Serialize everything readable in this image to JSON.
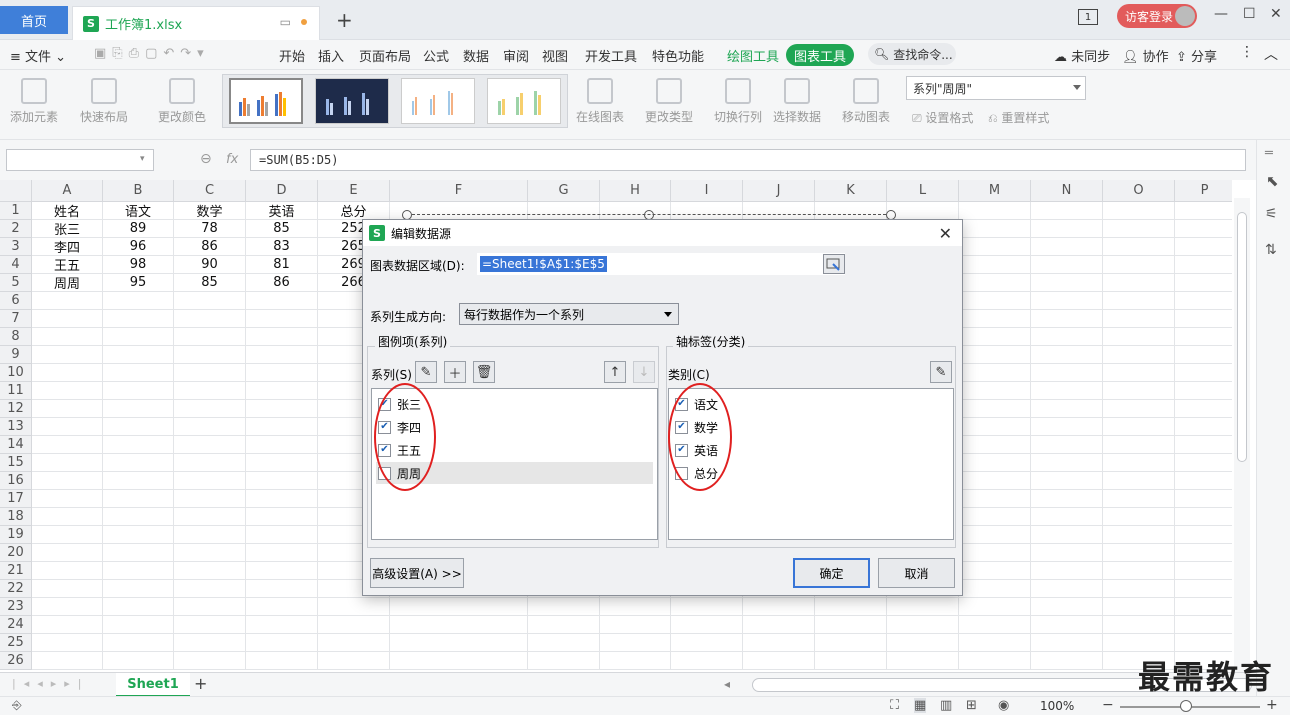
{
  "titlebar": {
    "home_tab": "首页",
    "doc_tab": "工作簿1.xlsx",
    "page_indicator": "1",
    "login": "访客登录"
  },
  "menu": {
    "file": "文件",
    "items": [
      "开始",
      "插入",
      "页面布局",
      "公式",
      "数据",
      "审阅",
      "视图",
      "开发工具",
      "特色功能"
    ],
    "drawing_tools": "绘图工具",
    "chart_tools": "图表工具",
    "search": "查找命令...",
    "unsynced": "未同步",
    "collab": "协作",
    "share": "分享"
  },
  "ribbon": {
    "add_element": "添加元素",
    "quick_layout": "快速布局",
    "change_color": "更改颜色",
    "online_chart": "在线图表",
    "change_type": "更改类型",
    "switch_rowcol": "切换行列",
    "select_data": "选择数据",
    "move_chart": "移动图表",
    "series_select": "系列\"周周\"",
    "set_format": "设置格式",
    "reset_style": "重置样式"
  },
  "formula_bar": {
    "namebox": "",
    "fx": "fx",
    "formula": "=SUM(B5:D5)"
  },
  "grid": {
    "columns": [
      "A",
      "B",
      "C",
      "D",
      "E",
      "F",
      "G",
      "H",
      "I",
      "J",
      "K",
      "L",
      "M",
      "N",
      "O",
      "P"
    ],
    "rows": [
      "1",
      "2",
      "3",
      "4",
      "5",
      "6",
      "7",
      "8",
      "9",
      "10",
      "11",
      "12",
      "13",
      "14",
      "15",
      "16",
      "17",
      "18",
      "19",
      "20",
      "21",
      "22",
      "23",
      "24",
      "25",
      "26"
    ],
    "data": [
      [
        "姓名",
        "语文",
        "数学",
        "英语",
        "总分"
      ],
      [
        "张三",
        "89",
        "78",
        "85",
        "252"
      ],
      [
        "李四",
        "96",
        "86",
        "83",
        "265"
      ],
      [
        "王五",
        "98",
        "90",
        "81",
        "269"
      ],
      [
        "周周",
        "95",
        "85",
        "86",
        "266"
      ]
    ]
  },
  "sheet": {
    "tab": "Sheet1"
  },
  "status": {
    "zoom": "100%"
  },
  "dialog": {
    "title": "编辑数据源",
    "range_label": "图表数据区域(D):",
    "range_value": "=Sheet1!$A$1:$E$5",
    "direction_label": "系列生成方向:",
    "direction_value": "每行数据作为一个系列",
    "legend_group": "图例项(系列)",
    "axis_group": "轴标签(分类)",
    "series_label": "系列(S)",
    "category_label": "类别(C)",
    "series": [
      {
        "name": "张三",
        "checked": true
      },
      {
        "name": "李四",
        "checked": true
      },
      {
        "name": "王五",
        "checked": true
      },
      {
        "name": "周周",
        "checked": false
      }
    ],
    "categories": [
      {
        "name": "语文",
        "checked": true
      },
      {
        "name": "数学",
        "checked": true
      },
      {
        "name": "英语",
        "checked": true
      },
      {
        "name": "总分",
        "checked": false
      }
    ],
    "advanced": "高级设置(A) >>",
    "ok": "确定",
    "cancel": "取消"
  },
  "watermark": "最需教育",
  "colors": {
    "accent_green": "#1fa654",
    "home_blue": "#3f7fd9",
    "selection_blue": "#3875d7",
    "annotation_red": "#e02020"
  }
}
